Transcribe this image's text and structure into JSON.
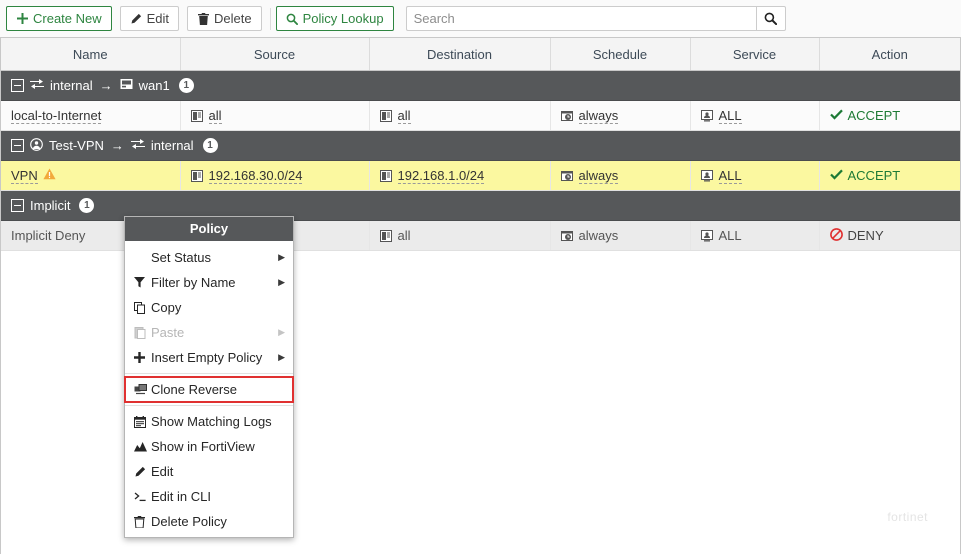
{
  "toolbar": {
    "buttons": [
      {
        "label": "Create New",
        "icon": "plus-icon",
        "style": "green"
      },
      {
        "label": "Edit",
        "icon": "pencil-icon",
        "style": "plain"
      },
      {
        "label": "Delete",
        "icon": "trash-icon",
        "style": "plain"
      },
      {
        "label": "Policy Lookup",
        "icon": "search-icon",
        "style": "green"
      }
    ],
    "search": {
      "placeholder": "Search",
      "value": "",
      "button_icon": "search-icon"
    }
  },
  "table": {
    "columns": [
      "Name",
      "Source",
      "Destination",
      "Schedule",
      "Service",
      "Action"
    ],
    "groups": [
      {
        "from": "internal",
        "from_icon": "interface-icon",
        "to": "wan1",
        "to_icon": "wan-icon",
        "arrow": "→",
        "count": "1",
        "rows": [
          {
            "name": "local-to-Internet",
            "name_warning": false,
            "source": "all",
            "destination": "all",
            "schedule": "always",
            "service": "ALL",
            "action": "ACCEPT",
            "action_type": "accept",
            "highlight": false
          }
        ]
      },
      {
        "from": "Test-VPN",
        "from_icon": "vpn-tunnel-icon",
        "to": "internal",
        "to_icon": "interface-icon",
        "arrow": "→",
        "count": "1",
        "rows": [
          {
            "name": "VPN",
            "name_warning": true,
            "source": "192.168.30.0/24",
            "destination": "192.168.1.0/24",
            "schedule": "always",
            "service": "ALL",
            "action": "ACCEPT",
            "action_type": "accept",
            "highlight": true
          }
        ]
      },
      {
        "from": "Implicit",
        "from_icon": "",
        "to": "",
        "to_icon": "",
        "arrow": "",
        "count": "1",
        "rows": [
          {
            "name": "Implicit Deny",
            "name_warning": false,
            "source": "",
            "destination": "all",
            "schedule": "always",
            "service": "ALL",
            "action": "DENY",
            "action_type": "deny",
            "highlight": false,
            "implicit": true
          }
        ]
      }
    ]
  },
  "context_menu": {
    "title": "Policy",
    "items": [
      {
        "label": "Set Status",
        "icon": "",
        "submenu": true,
        "disabled": false,
        "highlighted": false,
        "separator_before": false
      },
      {
        "label": "Filter by Name",
        "icon": "filter-icon",
        "submenu": true,
        "disabled": false,
        "highlighted": false,
        "separator_before": false
      },
      {
        "label": "Copy",
        "icon": "copy-icon",
        "submenu": false,
        "disabled": false,
        "highlighted": false,
        "separator_before": false
      },
      {
        "label": "Paste",
        "icon": "paste-icon",
        "submenu": true,
        "disabled": true,
        "highlighted": false,
        "separator_before": false
      },
      {
        "label": "Insert Empty Policy",
        "icon": "plus-icon",
        "submenu": true,
        "disabled": false,
        "highlighted": false,
        "separator_before": false
      },
      {
        "label": "Clone Reverse",
        "icon": "clone-icon",
        "submenu": false,
        "disabled": false,
        "highlighted": true,
        "separator_before": true
      },
      {
        "label": "Show Matching Logs",
        "icon": "logs-icon",
        "submenu": false,
        "disabled": false,
        "highlighted": false,
        "separator_before": true
      },
      {
        "label": "Show in FortiView",
        "icon": "fortiview-icon",
        "submenu": false,
        "disabled": false,
        "highlighted": false,
        "separator_before": false
      },
      {
        "label": "Edit",
        "icon": "pencil-icon",
        "submenu": false,
        "disabled": false,
        "highlighted": false,
        "separator_before": false
      },
      {
        "label": "Edit in CLI",
        "icon": "cli-icon",
        "submenu": false,
        "disabled": false,
        "highlighted": false,
        "separator_before": false
      },
      {
        "label": "Delete Policy",
        "icon": "trash-icon",
        "submenu": false,
        "disabled": false,
        "highlighted": false,
        "separator_before": false
      }
    ]
  },
  "watermark": "fortinet",
  "colors": {
    "accent_green": "#2e8540",
    "highlight_row": "#fbf8a0",
    "group_header": "#56585a",
    "deny_red": "#e03131",
    "warning_amber": "#f2a93b"
  }
}
